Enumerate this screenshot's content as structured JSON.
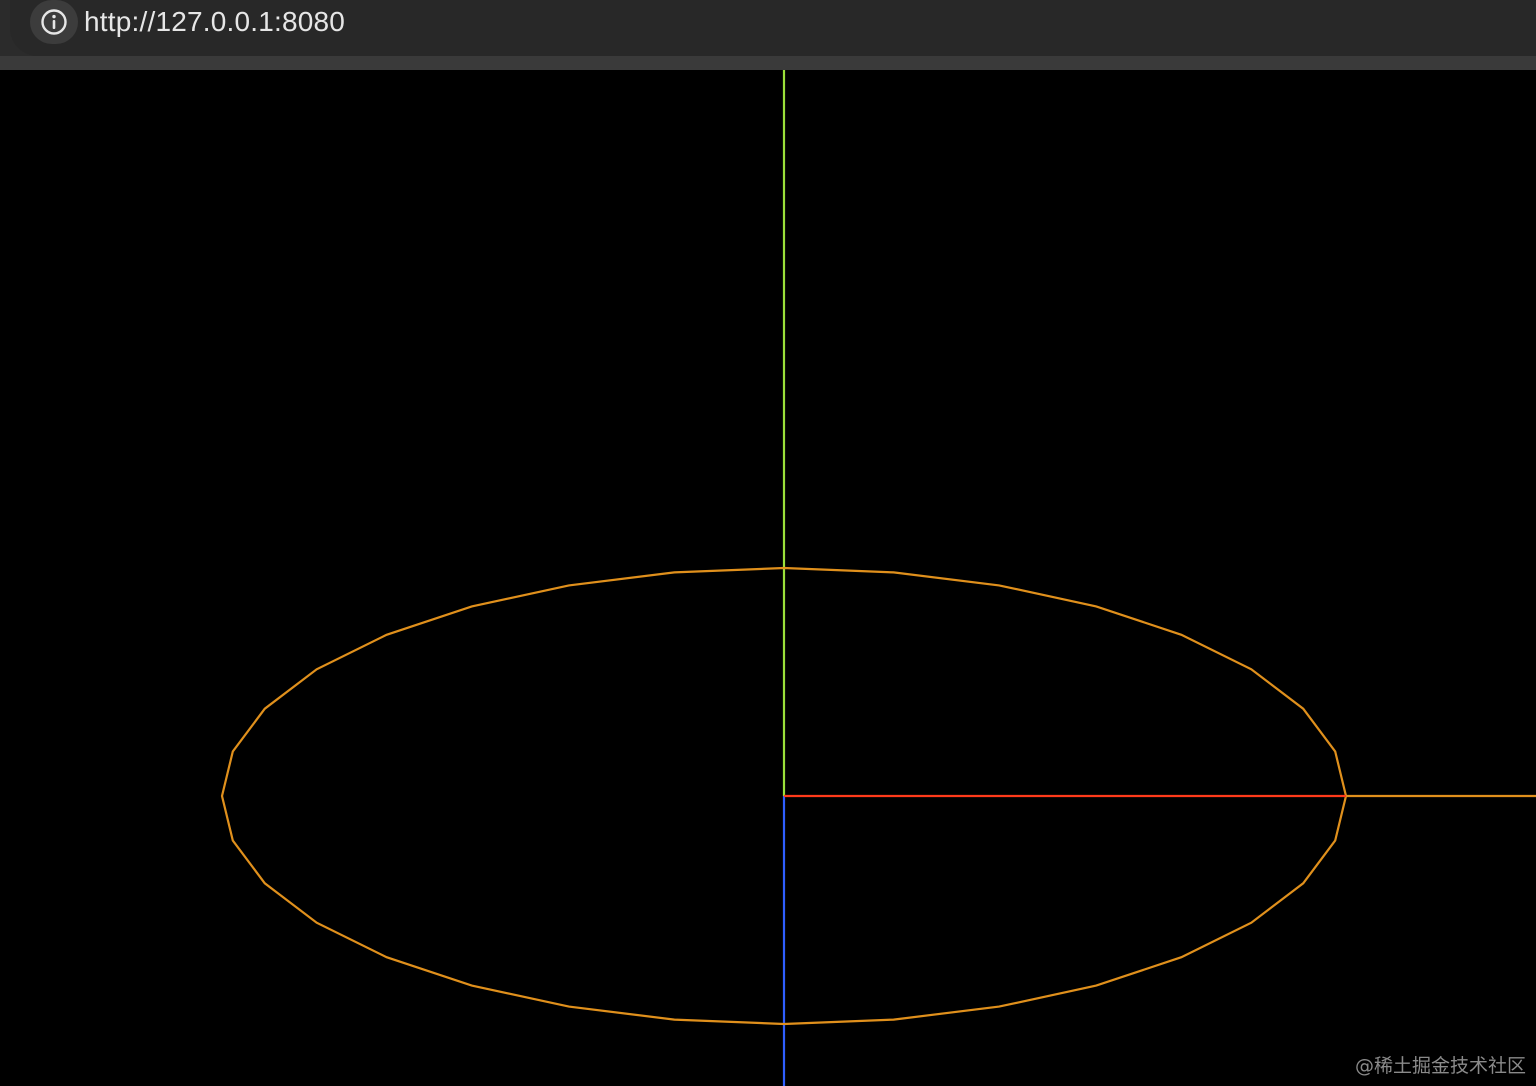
{
  "browser": {
    "url": "http://127.0.0.1:8080",
    "info_icon": "info-circle-icon"
  },
  "scene": {
    "background_color": "#000000",
    "axes": {
      "x_color": "#ff3a1a",
      "y_color": "#9be03a",
      "z_color": "#2f5fff"
    },
    "ellipse": {
      "color": "#e0901c",
      "segments": 32
    }
  },
  "watermark": {
    "text": "@稀土掘金技术社区"
  }
}
